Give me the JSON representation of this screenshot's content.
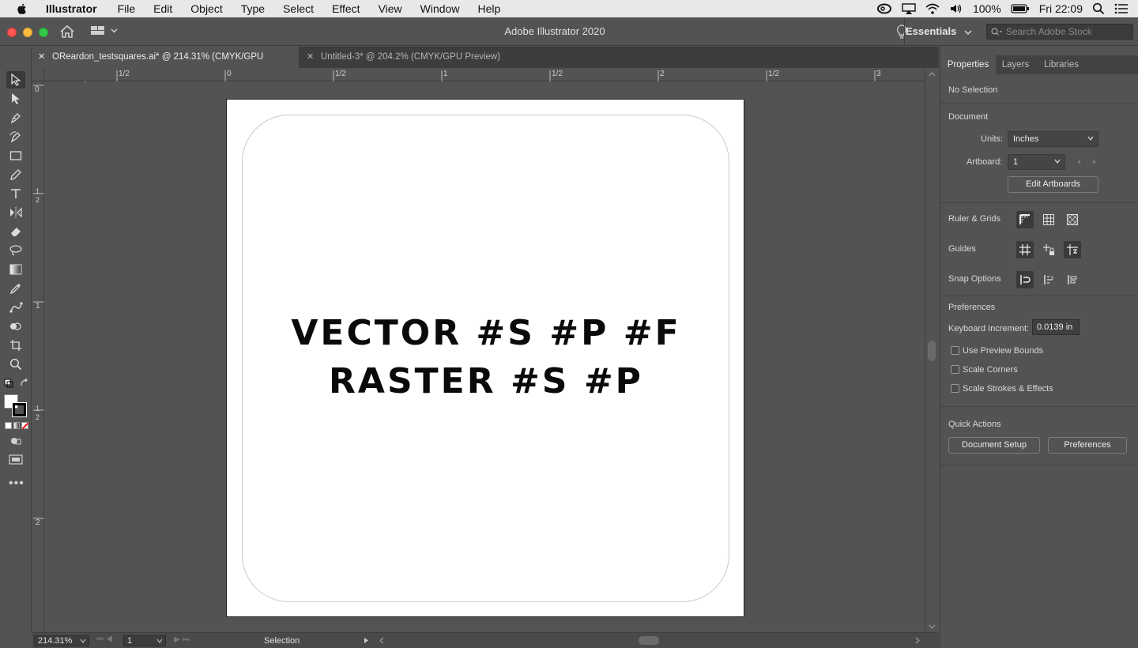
{
  "menubar": {
    "app_name": "Illustrator",
    "items": [
      "File",
      "Edit",
      "Object",
      "Type",
      "Select",
      "Effect",
      "View",
      "Window",
      "Help"
    ],
    "battery": "100%",
    "clock": "Fri 22:09"
  },
  "window": {
    "title": "Adobe Illustrator 2020",
    "workspace": "Essentials",
    "search_placeholder": "Search Adobe Stock"
  },
  "tabs": [
    {
      "label": "OReardon_testsquares.ai* @ 214.31% (CMYK/GPU Preview)",
      "active": true
    },
    {
      "label": "Untitled-3* @ 204.2% (CMYK/GPU Preview)",
      "active": false
    }
  ],
  "rulers": {
    "horizontal": [
      "1/2",
      "0",
      "1/2",
      "1",
      "1/2",
      "2",
      "1/2",
      "3"
    ],
    "vertical": [
      "0",
      "1",
      "2",
      "1",
      "1",
      "2",
      "2"
    ]
  },
  "artboard": {
    "line1": "VECTOR #S #P #F",
    "line2": "RASTER #S #P"
  },
  "statusbar": {
    "zoom": "214.31%",
    "artboard_num": "1",
    "tool": "Selection"
  },
  "panel": {
    "tabs": [
      "Properties",
      "Layers",
      "Libraries"
    ],
    "no_selection": "No Selection",
    "document_heading": "Document",
    "units_label": "Units:",
    "units_value": "Inches",
    "artboard_label": "Artboard:",
    "artboard_value": "1",
    "edit_artboards": "Edit Artboards",
    "ruler_grids": "Ruler & Grids",
    "guides": "Guides",
    "snap_options": "Snap Options",
    "preferences_heading": "Preferences",
    "keyboard_increment_label": "Keyboard Increment:",
    "keyboard_increment_value": "0.0139 in",
    "use_preview_bounds": "Use Preview Bounds",
    "scale_corners": "Scale Corners",
    "scale_strokes": "Scale Strokes & Effects",
    "quick_actions": "Quick Actions",
    "document_setup": "Document Setup",
    "preferences_button": "Preferences"
  },
  "colors": {
    "chrome": "#535353",
    "artboard": "#ffffff",
    "text": "#0a0a0a"
  }
}
